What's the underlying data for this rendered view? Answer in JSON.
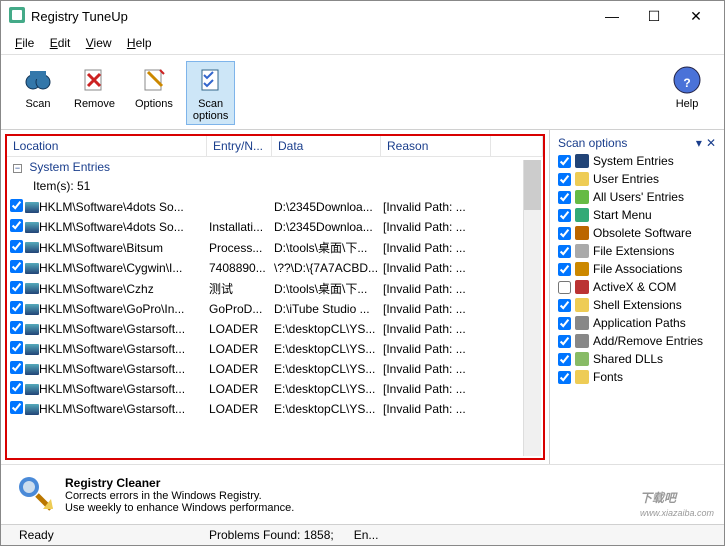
{
  "window": {
    "title": "Registry TuneUp"
  },
  "menu": {
    "file": "File",
    "edit": "Edit",
    "view": "View",
    "help": "Help"
  },
  "toolbar": {
    "scan": "Scan",
    "remove": "Remove",
    "options": "Options",
    "scan_options": "Scan\noptions",
    "help": "Help"
  },
  "columns": {
    "location": "Location",
    "entry": "Entry/N...",
    "data": "Data",
    "reason": "Reason"
  },
  "tree": {
    "group1": "System Entries",
    "items_label": "Item(s): 51"
  },
  "rows": [
    {
      "loc": "HKLM\\Software\\4dots So...",
      "entry": "",
      "data": "D:\\2345Downloa...",
      "reason": "[Invalid Path: ..."
    },
    {
      "loc": "HKLM\\Software\\4dots So...",
      "entry": "Installati...",
      "data": "D:\\2345Downloa...",
      "reason": "[Invalid Path: ..."
    },
    {
      "loc": "HKLM\\Software\\Bitsum",
      "entry": "Process...",
      "data": "D:\\tools\\桌面\\下...",
      "reason": "[Invalid Path: ..."
    },
    {
      "loc": "HKLM\\Software\\Cygwin\\I...",
      "entry": "7408890...",
      "data": "\\??\\D:\\{7A7ACBD...",
      "reason": "[Invalid Path: ..."
    },
    {
      "loc": "HKLM\\Software\\Czhz",
      "entry": "测试",
      "data": "D:\\tools\\桌面\\下...",
      "reason": "[Invalid Path: ..."
    },
    {
      "loc": "HKLM\\Software\\GoPro\\In...",
      "entry": "GoProD...",
      "data": "D:\\iTube Studio ...",
      "reason": "[Invalid Path: ..."
    },
    {
      "loc": "HKLM\\Software\\Gstarsoft...",
      "entry": "LOADER",
      "data": "E:\\desktopCL\\YS...",
      "reason": "[Invalid Path: ..."
    },
    {
      "loc": "HKLM\\Software\\Gstarsoft...",
      "entry": "LOADER",
      "data": "E:\\desktopCL\\YS...",
      "reason": "[Invalid Path: ..."
    },
    {
      "loc": "HKLM\\Software\\Gstarsoft...",
      "entry": "LOADER",
      "data": "E:\\desktopCL\\YS...",
      "reason": "[Invalid Path: ..."
    },
    {
      "loc": "HKLM\\Software\\Gstarsoft...",
      "entry": "LOADER",
      "data": "E:\\desktopCL\\YS...",
      "reason": "[Invalid Path: ..."
    },
    {
      "loc": "HKLM\\Software\\Gstarsoft...",
      "entry": "LOADER",
      "data": "E:\\desktopCL\\YS...",
      "reason": "[Invalid Path: ..."
    }
  ],
  "sidepanel": {
    "title": "Scan options",
    "items": [
      {
        "label": "System Entries",
        "checked": true,
        "color": "#247"
      },
      {
        "label": "User Entries",
        "checked": true,
        "color": "#ec5"
      },
      {
        "label": "All Users' Entries",
        "checked": true,
        "color": "#6b4"
      },
      {
        "label": "Start Menu",
        "checked": true,
        "color": "#3a7"
      },
      {
        "label": "Obsolete Software",
        "checked": true,
        "color": "#b60"
      },
      {
        "label": "File Extensions",
        "checked": true,
        "color": "#aaa"
      },
      {
        "label": "File Associations",
        "checked": true,
        "color": "#c80"
      },
      {
        "label": "ActiveX & COM",
        "checked": false,
        "color": "#b33"
      },
      {
        "label": "Shell Extensions",
        "checked": true,
        "color": "#ec5"
      },
      {
        "label": "Application Paths",
        "checked": true,
        "color": "#888"
      },
      {
        "label": "Add/Remove Entries",
        "checked": true,
        "color": "#888"
      },
      {
        "label": "Shared DLLs",
        "checked": true,
        "color": "#8b6"
      },
      {
        "label": "Fonts",
        "checked": true,
        "color": "#ec5"
      }
    ]
  },
  "footer": {
    "title": "Registry Cleaner",
    "line1": "Corrects errors in the Windows Registry.",
    "line2": "Use weekly to enhance Windows performance.",
    "watermark": "下载吧",
    "watermark_sub": "www.xiazaiba.com"
  },
  "status": {
    "ready": "Ready",
    "problems": "Problems Found: 1858;",
    "entries": "En..."
  }
}
